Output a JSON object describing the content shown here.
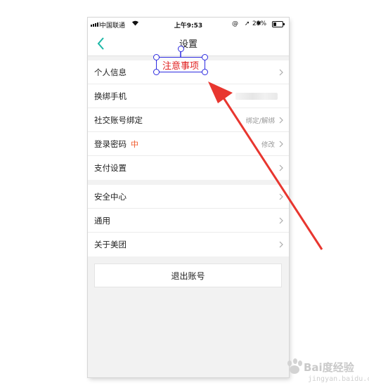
{
  "status_bar": {
    "carrier": "中国联通",
    "time": "上午9:53",
    "status_icons": "@ ➚ ✱",
    "battery": "29%"
  },
  "navbar": {
    "title": "设置",
    "back_icon": "chevron-left-icon",
    "accent": "#1bb7a6"
  },
  "settings": {
    "group1": [
      {
        "label": "个人信息"
      },
      {
        "label": "换绑手机"
      },
      {
        "label": "社交账号绑定",
        "value": "绑定/解绑"
      },
      {
        "label": "登录密码",
        "badge": "中",
        "value": "修改"
      },
      {
        "label": "支付设置"
      }
    ],
    "group2": [
      {
        "label": "安全中心"
      },
      {
        "label": "通用"
      },
      {
        "label": "关于美团"
      }
    ],
    "logout": "退出账号"
  },
  "annotation": {
    "text": "注意事项",
    "text_color": "#e02020",
    "box_color": "#2d2be0",
    "arrow_color": "#e8362f"
  },
  "watermark": {
    "text": "Bai度经验",
    "sub": "jingyan.baidu.com"
  }
}
